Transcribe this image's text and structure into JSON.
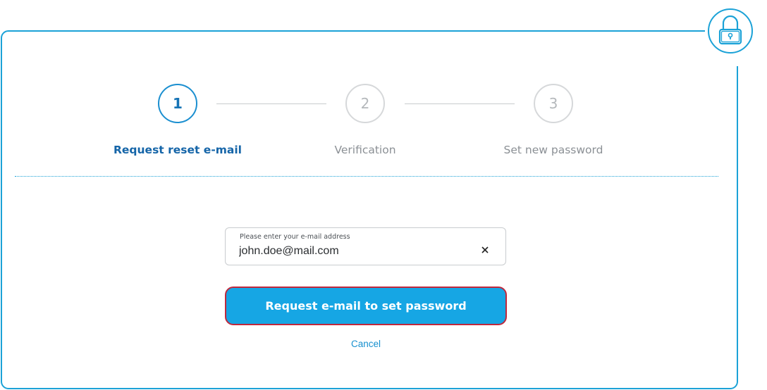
{
  "stepper": {
    "steps": [
      {
        "number": "1",
        "label": "Request reset e-mail",
        "state": "active"
      },
      {
        "number": "2",
        "label": "Verification",
        "state": "inactive"
      },
      {
        "number": "3",
        "label": "Set new password",
        "state": "inactive"
      }
    ]
  },
  "form": {
    "email_label": "Please enter your e-mail address",
    "email_value": "john.doe@mail.com",
    "clear_icon": "close-icon",
    "submit_label": "Request e-mail to set password",
    "cancel_label": "Cancel"
  },
  "icons": {
    "badge": "lock-icon"
  },
  "colors": {
    "accent": "#1ba2d7",
    "button_bg": "#16a6e4",
    "button_border": "#c0283c",
    "active_step": "#1565a8",
    "link": "#1790cf"
  }
}
